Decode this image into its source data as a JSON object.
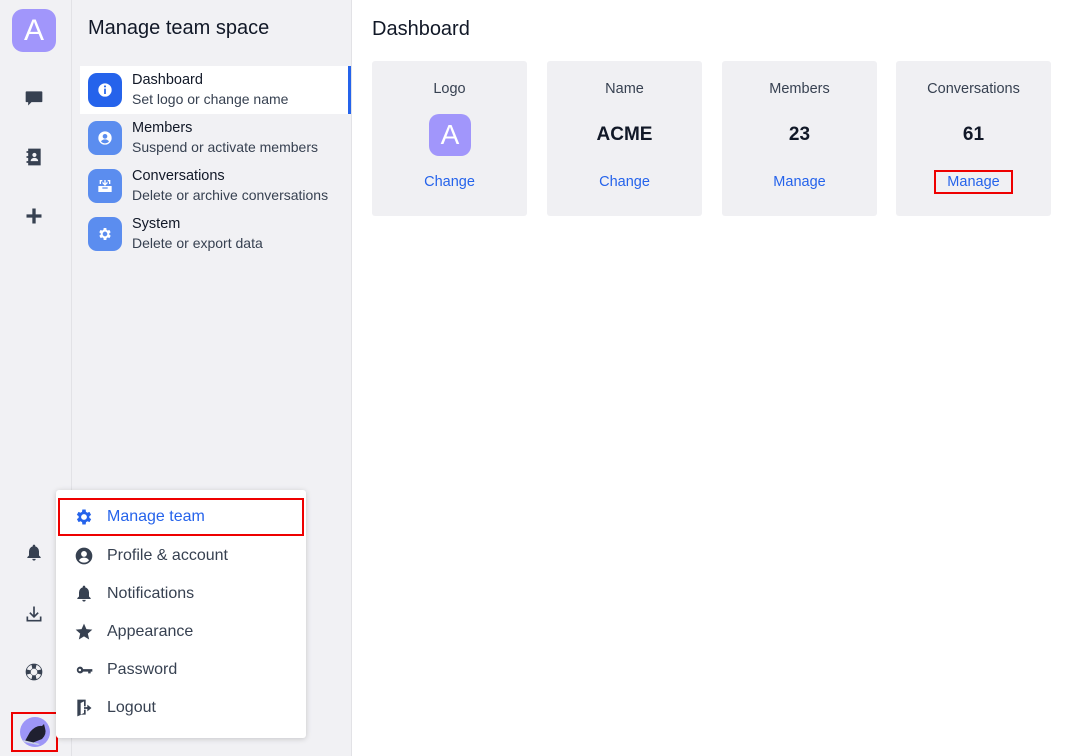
{
  "rail": {
    "team_initial": "A",
    "top_icons": [
      "chat-icon",
      "contacts-icon",
      "plus-icon"
    ],
    "bottom_icons": [
      "bell-icon",
      "download-icon",
      "lifebuoy-icon"
    ]
  },
  "pane": {
    "title": "Manage team space",
    "items": [
      {
        "label": "Dashboard",
        "sub": "Set logo or change name",
        "icon": "info-icon",
        "active": true
      },
      {
        "label": "Members",
        "sub": "Suspend or activate members",
        "icon": "user-icon",
        "active": false
      },
      {
        "label": "Conversations",
        "sub": "Delete or archive conversations",
        "icon": "archive-icon",
        "active": false
      },
      {
        "label": "System",
        "sub": "Delete or export data",
        "icon": "gear-icon",
        "active": false
      }
    ]
  },
  "main": {
    "title": "Dashboard",
    "cards": [
      {
        "title": "Logo",
        "logo_initial": "A",
        "link": "Change"
      },
      {
        "title": "Name",
        "value": "ACME",
        "link": "Change"
      },
      {
        "title": "Members",
        "value": "23",
        "link": "Manage"
      },
      {
        "title": "Conversations",
        "value": "61",
        "link": "Manage"
      }
    ]
  },
  "menu": {
    "items": [
      {
        "label": "Manage team",
        "icon": "gear-icon"
      },
      {
        "label": "Profile & account",
        "icon": "user-circle-icon"
      },
      {
        "label": "Notifications",
        "icon": "bell-icon"
      },
      {
        "label": "Appearance",
        "icon": "star-icon"
      },
      {
        "label": "Password",
        "icon": "key-icon"
      },
      {
        "label": "Logout",
        "icon": "logout-icon"
      }
    ]
  },
  "colors": {
    "accent": "#2563eb",
    "logo": "#a196fb",
    "highlight": "#ee0000"
  }
}
